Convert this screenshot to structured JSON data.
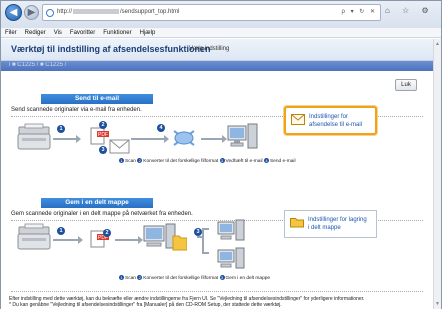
{
  "browser": {
    "url_prefix": "http://",
    "url_suffix": "/sendsupport_top.html",
    "tools": "ρ ▾ ↻ ✕",
    "icons": "⌂ ☆ ⚙"
  },
  "menu": [
    "Filer",
    "Rediger",
    "Vis",
    "Favoritter",
    "Funktioner",
    "Hjælp"
  ],
  "header": {
    "title": "Værktøj til indstilling af afsendelsesfunktionen",
    "subtitle": "Vælg indstilling",
    "crumb": "i ■ C1225 / ■ C1225 /"
  },
  "close_label": "Luk",
  "email_section": {
    "heading": "Send til e-mail",
    "description": "Send scannede originaler via e-mail fra enheden.",
    "link_label": "Indstillinger for afsendelse til e-mail",
    "caption": [
      "Scan",
      "Konverter til det forskellige filformat",
      "Vedhæft til e-mail",
      "Send e-mail"
    ]
  },
  "folder_section": {
    "heading": "Gem i en delt mappe",
    "description": "Gem scannede originaler i en delt mappe på netværket fra enheden.",
    "link_label": "Indstillinger for lagring i delt mappe",
    "caption": [
      "Scan",
      "Konverter til det forskellige filformat",
      "Gem i en delt mappe"
    ]
  },
  "footer": {
    "line1": "Efter indstilling med dette værktøj, kan du bekræfte eller ændre indstillingerne fra Fjern UI. Se \"Vejledning til afsendelsesindstillinger\" for yderligere informationer.",
    "line2": "* Du kan genåbne \"Vejledning til afsendelsesindstillinger\" fra [Manualer] på den CD-ROM Setup, der stattede dette værktøj."
  },
  "colors": {
    "accent": "#2a6fc2",
    "highlight": "#f0a21a",
    "step": "#1d4f9d"
  }
}
